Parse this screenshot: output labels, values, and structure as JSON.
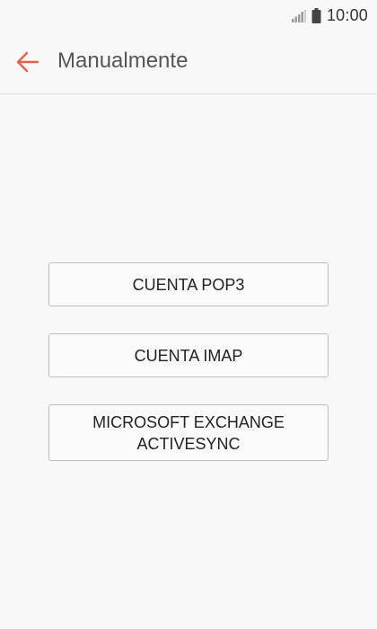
{
  "status_bar": {
    "time": "10:00",
    "icons": [
      "signal-icon",
      "battery-icon"
    ]
  },
  "header": {
    "back_icon": "back-arrow-icon",
    "title": "Manualmente",
    "accent_color": "#e0624f"
  },
  "options": [
    {
      "label": "CUENTA POP3"
    },
    {
      "label": "CUENTA IMAP"
    },
    {
      "label_line1": "MICROSOFT EXCHANGE",
      "label_line2": "ACTIVESYNC"
    }
  ]
}
